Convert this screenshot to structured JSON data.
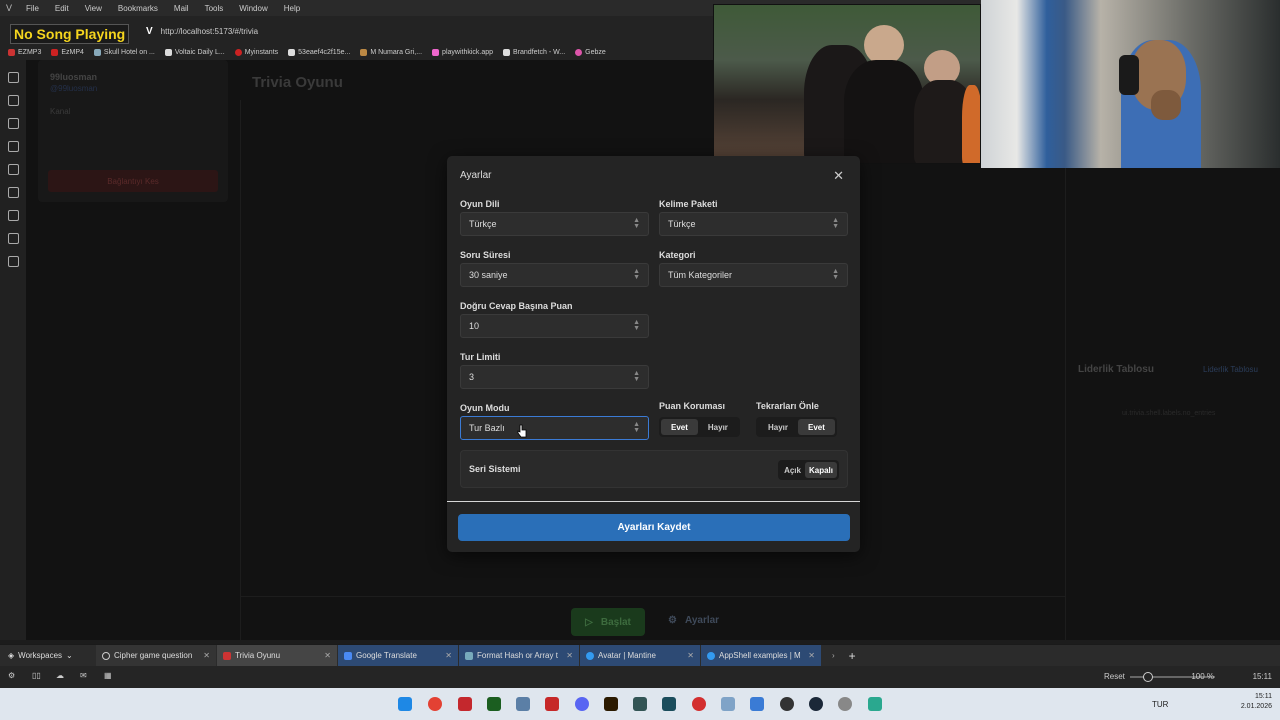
{
  "browser": {
    "menu": [
      "File",
      "Edit",
      "View",
      "Bookmarks",
      "Mail",
      "Tools",
      "Window",
      "Help"
    ],
    "overlay_text": "No Song Playing",
    "url": "http://localhost:5173/#/trivia",
    "bookmarks": [
      "EZMP3",
      "EzMP4",
      "Skull Hotel on ...",
      "Voltaic Daily L...",
      "Myinstants",
      "53eaef4c2f15e...",
      "M Numara Gri,...",
      "playwithkick.app",
      "Brandfetch - W...",
      "Gebze"
    ],
    "tabs": [
      {
        "label": "Workspaces"
      },
      {
        "label": "Cipher game question"
      },
      {
        "label": "Trivia Oyunu"
      },
      {
        "label": "Google Translate"
      },
      {
        "label": "Format Hash or Array t"
      },
      {
        "label": "Avatar | Mantine"
      },
      {
        "label": "AppShell examples | M"
      }
    ],
    "zoom_reset": "Reset",
    "zoom": "100 %",
    "time": "15:11"
  },
  "app": {
    "title": "Trivia Oyunu",
    "user": "99luosman",
    "user_sub": "@99luosman",
    "channel_label": "Kanal",
    "disconnect_label": "Bağlantıyı Kes",
    "start_label": "Başlat",
    "settings_label": "Ayarlar",
    "leaderboard_title": "Liderlik Tablosu",
    "leaderboard_link": "Liderlik Tablosu",
    "leaderboard_empty": "ui.trivia.shell.labels.no_entries"
  },
  "modal": {
    "title": "Ayarlar",
    "game_language": {
      "label": "Oyun Dili",
      "value": "Türkçe"
    },
    "word_pack": {
      "label": "Kelime Paketi",
      "value": "Türkçe"
    },
    "question_time": {
      "label": "Soru Süresi",
      "value": "30 saniye"
    },
    "category": {
      "label": "Kategori",
      "value": "Tüm Kategoriler"
    },
    "points_per_answer": {
      "label": "Doğru Cevap Başına Puan",
      "value": "10"
    },
    "round_limit": {
      "label": "Tur Limiti",
      "value": "3"
    },
    "game_mode": {
      "label": "Oyun Modu",
      "value": "Tur Bazlı"
    },
    "score_protection": {
      "label": "Puan Koruması",
      "yes": "Evet",
      "no": "Hayır",
      "selected": "Evet"
    },
    "prevent_repeats": {
      "label": "Tekrarları Önle",
      "no": "Hayır",
      "yes": "Evet",
      "selected": "Evet"
    },
    "streak": {
      "label": "Seri Sistemi",
      "on": "Açık",
      "off": "Kapalı",
      "selected": "Kapalı"
    },
    "save_label": "Ayarları Kaydet"
  },
  "taskbar": {
    "lang": "TUR",
    "time": "15:11",
    "date": "2.01.2026"
  },
  "colors": {
    "accent": "#2a6fb8",
    "modal_bg": "#242424",
    "app_bg": "#121212"
  }
}
